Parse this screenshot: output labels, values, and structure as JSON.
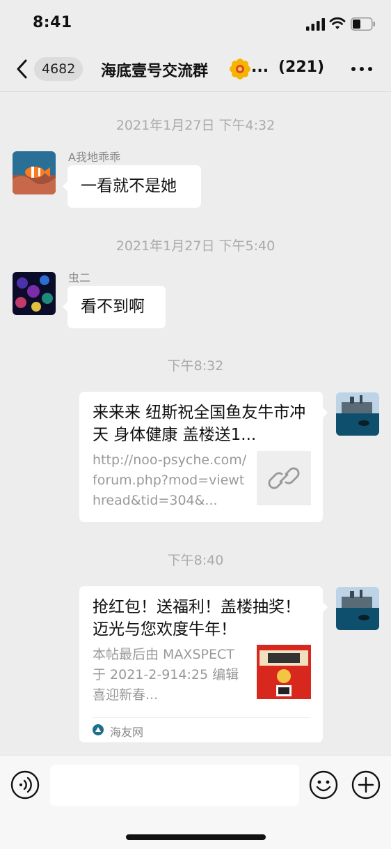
{
  "status_bar": {
    "time": "8:41"
  },
  "nav": {
    "unread_count": "4682",
    "title": "海底壹号交流群",
    "title_ellipsis": "...",
    "member_count": "(221)"
  },
  "messages": [
    {
      "timestamp": "2021年1月27日 下午4:32",
      "sender": "A我地乖乖",
      "text": "一看就不是她"
    },
    {
      "timestamp": "2021年1月27日 下午5:40",
      "sender": "虫二",
      "text": "看不到啊"
    }
  ],
  "link_cards": [
    {
      "timestamp": "下午8:32",
      "title": "来来来 纽斯祝全国鱼友牛市冲天 身体健康 盖楼送1...",
      "description": "http://noo-psyche.com/forum.php?mod=viewthread&tid=304&...",
      "thumb_icon": "link-icon"
    },
    {
      "timestamp": "下午8:40",
      "title": "抢红包！送福利！盖楼抽奖！迈光与您欢度牛年！",
      "description": "本帖最后由 MAXSPECT 于 2021-2-914:25 编辑喜迎新春...",
      "source": "海友网"
    }
  ],
  "input": {
    "placeholder": ""
  },
  "colors": {
    "background": "#ededed",
    "bubble": "#ffffff",
    "timestamp": "#aaaaaa",
    "link_thumb_bg": "#eeeeee",
    "red_packet": "#d8281e"
  }
}
